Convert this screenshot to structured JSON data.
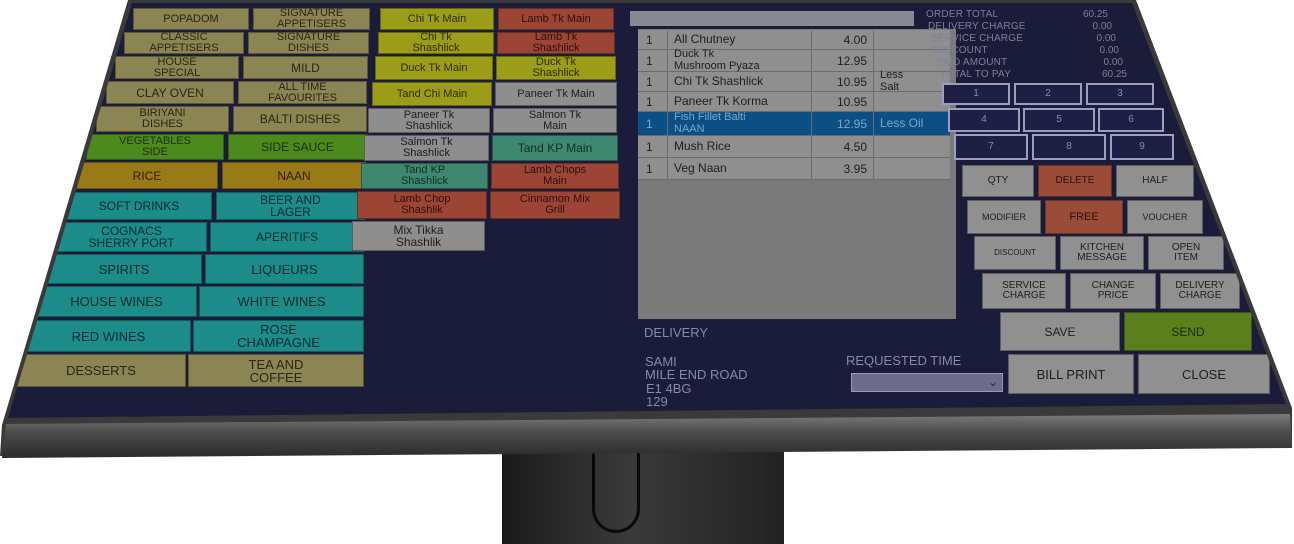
{
  "categories": [
    {
      "label": "POPADOM",
      "color": "olive"
    },
    {
      "label": "SIGNATURE\nAPPETISERS",
      "color": "olive"
    },
    {
      "label": "CLASSIC\nAPPETISERS",
      "color": "olive"
    },
    {
      "label": "SIGNATURE\nDISHES",
      "color": "olive"
    },
    {
      "label": "HOUSE\nSPECIAL",
      "color": "olive"
    },
    {
      "label": "MILD",
      "color": "olive"
    },
    {
      "label": "CLAY OVEN",
      "color": "olive"
    },
    {
      "label": "ALL TIME\nFAVOURITES",
      "color": "olive"
    },
    {
      "label": "BIRIYANI\nDISHES",
      "color": "olive"
    },
    {
      "label": "BALTI DISHES",
      "color": "olive"
    },
    {
      "label": "VEGETABLES\nSIDE",
      "color": "green"
    },
    {
      "label": "SIDE SAUCE",
      "color": "green"
    },
    {
      "label": "RICE",
      "color": "amber"
    },
    {
      "label": "NAAN",
      "color": "amber"
    },
    {
      "label": "SOFT DRINKS",
      "color": "teal"
    },
    {
      "label": "BEER AND\nLAGER",
      "color": "teal"
    },
    {
      "label": "COGNACS\nSHERRY  PORT",
      "color": "teal"
    },
    {
      "label": "APERITIFS",
      "color": "teal"
    },
    {
      "label": "SPIRITS",
      "color": "teal"
    },
    {
      "label": "LIQUEURS",
      "color": "teal"
    },
    {
      "label": "HOUSE WINES",
      "color": "teal"
    },
    {
      "label": "WHITE WINES",
      "color": "teal"
    },
    {
      "label": "RED WINES",
      "color": "teal"
    },
    {
      "label": "ROSE\nCHAMPAGNE",
      "color": "teal"
    },
    {
      "label": "DESSERTS",
      "color": "olive"
    },
    {
      "label": "TEA AND\nCOFFEE",
      "color": "olive"
    }
  ],
  "items": [
    {
      "label": "Chi Tk Main",
      "color": "yellow"
    },
    {
      "label": "Lamb Tk Main",
      "color": "red"
    },
    {
      "label": "Chi Tk\nShashlick",
      "color": "yellow"
    },
    {
      "label": "Lamb Tk\nShashlick",
      "color": "red"
    },
    {
      "label": "Duck Tk Main",
      "color": "yellow"
    },
    {
      "label": "Duck Tk\nShashlick",
      "color": "yellow"
    },
    {
      "label": "Tand Chi Main",
      "color": "yellow"
    },
    {
      "label": "Paneer Tk Main",
      "color": "gray"
    },
    {
      "label": "Paneer Tk\nShashlick",
      "color": "gray"
    },
    {
      "label": "Salmon Tk\nMain",
      "color": "gray"
    },
    {
      "label": "Salmon Tk\nShashlick",
      "color": "gray"
    },
    {
      "label": "Tand KP Main",
      "color": "sea"
    },
    {
      "label": "Tand KP\nShashlick",
      "color": "sea"
    },
    {
      "label": "Lamb Chops\nMain",
      "color": "red"
    },
    {
      "label": "Lamb Chop\nShashlik",
      "color": "red"
    },
    {
      "label": "Cinnamon Mix\nGrill",
      "color": "red"
    },
    {
      "label": "Mix Tikka\nShashlik",
      "color": "gray"
    }
  ],
  "order": {
    "rows": [
      {
        "qty": "1",
        "name": "All Chutney",
        "price": "4.00",
        "note": "",
        "selected": false
      },
      {
        "qty": "1",
        "name": "Duck Tk\nMushroom Pyaza",
        "price": "12.95",
        "note": "",
        "selected": false
      },
      {
        "qty": "1",
        "name": "Chi Tk Shashlick",
        "price": "10.95",
        "note": "Less\nSalt",
        "selected": false
      },
      {
        "qty": "1",
        "name": "Paneer Tk Korma",
        "price": "10.95",
        "note": "",
        "selected": false
      },
      {
        "qty": "1",
        "name": "Fish Fillet Balti\nNAAN",
        "price": "12.95",
        "note": "Less Oil",
        "selected": true
      },
      {
        "qty": "1",
        "name": "Mush Rice",
        "price": "4.50",
        "note": "",
        "selected": false
      },
      {
        "qty": "1",
        "name": "Veg Naan",
        "price": "3.95",
        "note": "",
        "selected": false
      }
    ]
  },
  "summary": {
    "order_total_label": "ORDER TOTAL",
    "order_total": "60.25",
    "delivery_charge_label": "DELIVERY CHARGE",
    "delivery_charge": "0.00",
    "service_charge_label": "SERVICE CHARGE",
    "service_charge": "0.00",
    "discount_label": "DISCOUNT",
    "discount": "0.00",
    "paid_amount_label": "PAID AMOUNT",
    "paid_amount": "0.00",
    "total_to_pay_label": "TOTAL TO PAY",
    "total_to_pay": "60.25"
  },
  "keypad": [
    "1",
    "2",
    "3",
    "4",
    "5",
    "6",
    "7",
    "8",
    "9"
  ],
  "actions": {
    "qty": "QTY",
    "delete": "DELETE",
    "half": "HALF",
    "modifier": "MODIFIER",
    "free": "FREE",
    "voucher": "VOUCHER",
    "discount": "DISCOUNT",
    "kitchen_message": "KITCHEN\nMESSAGE",
    "open_item": "OPEN\nITEM",
    "service_charge": "SERVICE\nCHARGE",
    "change_price": "CHANGE\nPRICE",
    "delivery_charge": "DELIVERY\nCHARGE",
    "save": "SAVE",
    "send": "SEND",
    "bill_print": "BILL PRINT",
    "close": "CLOSE"
  },
  "delivery": {
    "type": "DELIVERY",
    "name": "SAMI",
    "street": "MILE END ROAD",
    "postcode": "E1 4BG",
    "number": "129",
    "requested_time_label": "REQUESTED TIME"
  }
}
